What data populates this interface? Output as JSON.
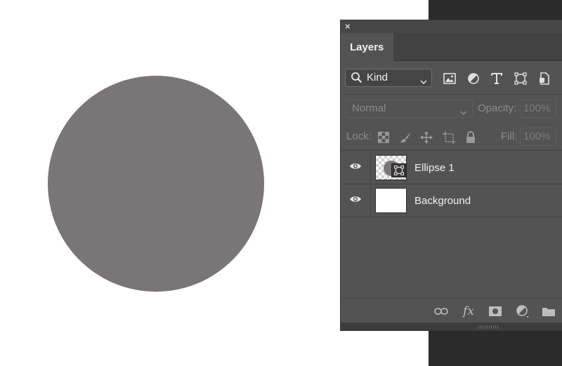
{
  "panel": {
    "tab_label": "Layers",
    "close_glyph": "×"
  },
  "filter": {
    "kind_label": "Kind",
    "icons": [
      "image-filter-icon",
      "adjustment-filter-icon",
      "type-filter-icon",
      "shape-filter-icon",
      "smart-object-filter-icon"
    ]
  },
  "blend": {
    "mode": "Normal",
    "opacity_label": "Opacity:",
    "opacity_value": "100%"
  },
  "lock": {
    "label": "Lock:",
    "fill_label": "Fill:",
    "fill_value": "100%"
  },
  "layers": [
    {
      "name": "Ellipse 1",
      "visible": true,
      "type": "shape"
    },
    {
      "name": "Background",
      "visible": true,
      "type": "pixel"
    }
  ],
  "colors": {
    "shape_fill": "#7a7677",
    "panel_bg": "#535353"
  }
}
